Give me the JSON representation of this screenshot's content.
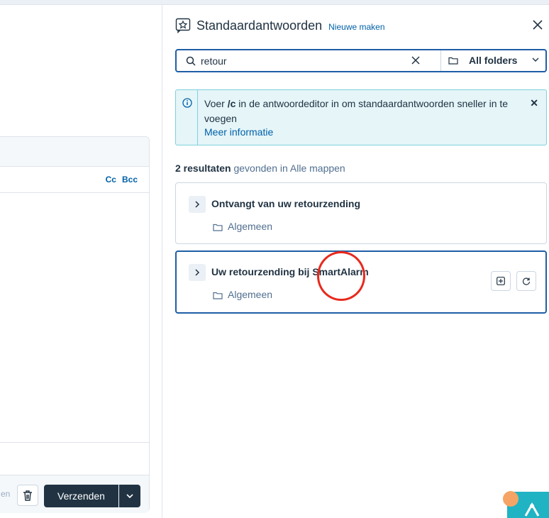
{
  "panel": {
    "title": "Standaardantwoorden",
    "new_link": "Nieuwe maken"
  },
  "search": {
    "query": "retour",
    "folder_filter": "All folders"
  },
  "info": {
    "text_before": "Voer ",
    "text_code": "/c",
    "text_after": " in de antwoordeditor in om standaardantwoorden sneller in te voegen",
    "link": "Meer informatie"
  },
  "results": {
    "count": "2 resultaten",
    "suffix": " gevonden in Alle mappen",
    "items": [
      {
        "title": "Ontvangt van uw retourzending",
        "folder": "Algemeen"
      },
      {
        "title": "Uw retourzending bij SmartAlarm",
        "folder": "Algemeen"
      }
    ]
  },
  "editor": {
    "cc": "Cc",
    "bcc": "Bcc",
    "footer_clip": "en",
    "send": "Verzenden"
  },
  "colors": {
    "accent": "#0061a8",
    "dark": "#213343",
    "highlight_ring": "#e8291c",
    "info_bg": "#e5f5f8"
  },
  "icons": [
    "template-icon",
    "close-icon",
    "search-icon",
    "clear-icon",
    "folder-icon",
    "chevron-down-icon",
    "info-icon",
    "chevron-right-icon",
    "insert-icon",
    "refresh-icon",
    "trash-icon",
    "chat-icon"
  ]
}
